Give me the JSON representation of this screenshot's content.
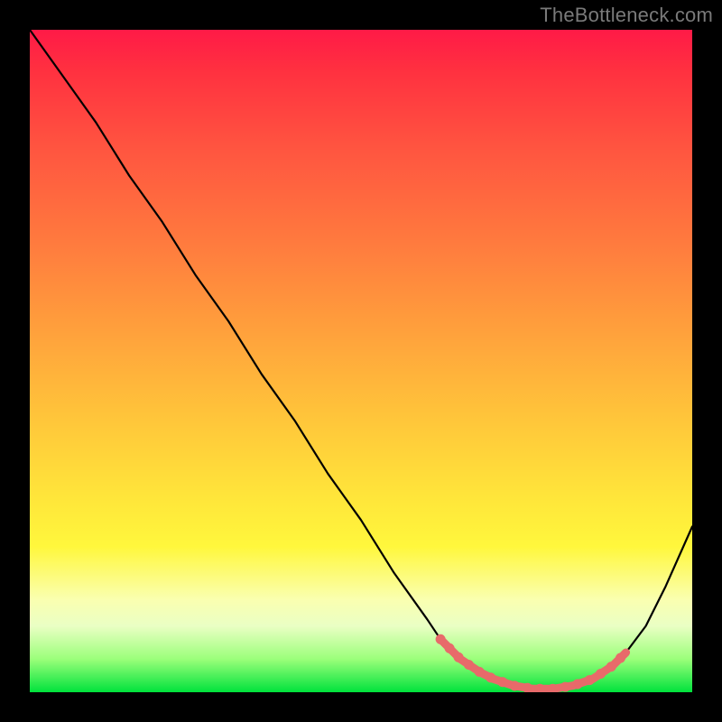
{
  "watermark": "TheBottleneck.com",
  "colors": {
    "page_bg": "#000000",
    "grad_top": "#ff1a47",
    "grad_mid1": "#ff7a3e",
    "grad_mid2": "#ffe43a",
    "grad_bottom": "#00e23c",
    "curve": "#000000",
    "highlight": "#e86a6a",
    "watermark": "#7a7a7a"
  },
  "chart_data": {
    "type": "line",
    "title": "",
    "xlabel": "",
    "ylabel": "",
    "xlim": [
      0,
      100
    ],
    "ylim": [
      0,
      100
    ],
    "grid": false,
    "legend": false,
    "series": [
      {
        "name": "bottleneck-curve",
        "x": [
          0,
          5,
          10,
          15,
          20,
          25,
          30,
          35,
          40,
          45,
          50,
          55,
          60,
          62,
          65,
          68,
          70,
          73,
          76,
          79,
          82,
          85,
          88,
          90,
          93,
          96,
          100
        ],
        "y": [
          100,
          93,
          86,
          78,
          71,
          63,
          56,
          48,
          41,
          33,
          26,
          18,
          11,
          8,
          5,
          3,
          2,
          1,
          0.5,
          0.5,
          1,
          2,
          4,
          6,
          10,
          16,
          25
        ]
      }
    ],
    "highlight_range_x": [
      62,
      90
    ],
    "annotations": []
  }
}
